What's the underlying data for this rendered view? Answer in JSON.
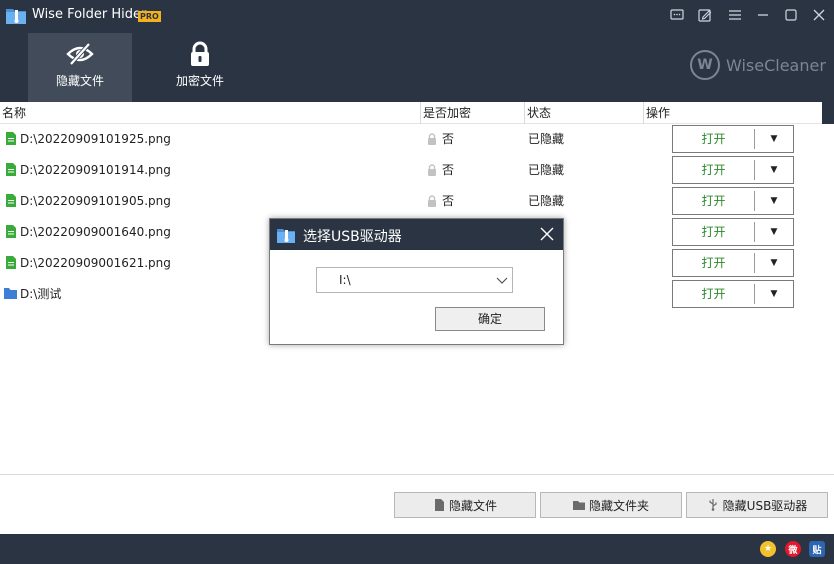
{
  "app": {
    "title": "Wise Folder Hider",
    "badge": "PRO",
    "brand": "WiseCleaner",
    "brand_mark": "W"
  },
  "window_controls": [
    "feedback-icon",
    "edit-icon",
    "menu-icon",
    "minimize-icon",
    "maximize-icon",
    "close-icon"
  ],
  "tabs": [
    {
      "label": "隐藏文件",
      "icon": "eye-slash-icon",
      "active": true
    },
    {
      "label": "加密文件",
      "icon": "lock-icon",
      "active": false
    }
  ],
  "table": {
    "headers": [
      "名称",
      "是否加密",
      "状态",
      "操作"
    ],
    "rows": [
      {
        "name": "D:\\20220909101925.png",
        "type": "file",
        "encrypted": "否",
        "state": "已隐藏",
        "action": "打开"
      },
      {
        "name": "D:\\20220909101914.png",
        "type": "file",
        "encrypted": "否",
        "state": "已隐藏",
        "action": "打开"
      },
      {
        "name": "D:\\20220909101905.png",
        "type": "file",
        "encrypted": "否",
        "state": "已隐藏",
        "action": "打开"
      },
      {
        "name": "D:\\20220909001640.png",
        "type": "file",
        "encrypted": "",
        "state": "",
        "action": "打开"
      },
      {
        "name": "D:\\20220909001621.png",
        "type": "file",
        "encrypted": "",
        "state": "",
        "action": "打开"
      },
      {
        "name": "D:\\测试",
        "type": "folder",
        "encrypted": "",
        "state": "",
        "action": "打开"
      }
    ],
    "arrow": "▼"
  },
  "bottom_buttons": [
    {
      "label": "隐藏文件",
      "icon": "file-icon"
    },
    {
      "label": "隐藏文件夹",
      "icon": "folder-icon"
    },
    {
      "label": "隐藏USB驱动器",
      "icon": "usb-icon"
    }
  ],
  "social": [
    {
      "icon": "star-icon",
      "color": "#f2c12e",
      "text": "★"
    },
    {
      "icon": "weibo-icon",
      "color": "#e6162d",
      "text": "微"
    },
    {
      "icon": "tieba-icon",
      "color": "#2d64b3",
      "text": "贴"
    }
  ],
  "dialog": {
    "title": "选择USB驱动器",
    "selected_drive": "I:\\",
    "ok_label": "确定"
  },
  "colors": {
    "header_bg": "#2b3442",
    "active_tab_bg": "#414b59",
    "open_text": "#2a8a2a",
    "file_icon": "#3aaa3a",
    "folder_icon": "#3d7fd6",
    "badge": "#f2b21b"
  }
}
